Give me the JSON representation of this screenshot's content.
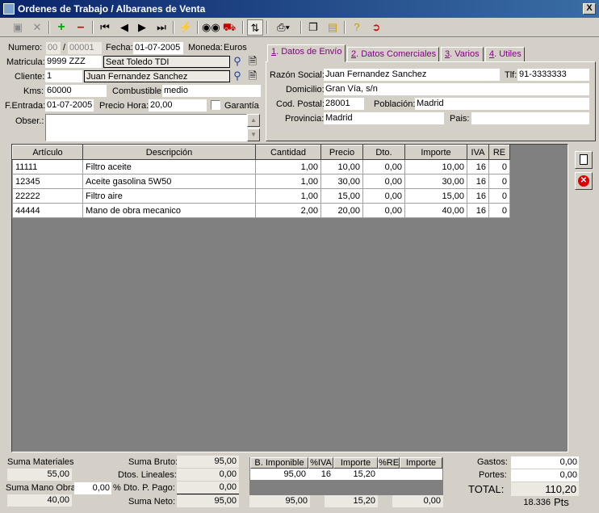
{
  "window": {
    "title": "Ordenes de Trabajo / Albaranes de Venta",
    "close_label": "X"
  },
  "toolbar": {
    "icons": [
      "save-icon",
      "cancel-icon",
      "add-icon",
      "delete-icon",
      "first-icon",
      "prev-icon",
      "next-icon",
      "last-icon",
      "lightning-icon",
      "binoculars-icon",
      "truck-icon",
      "sort-icon",
      "print-icon",
      "copy-icon",
      "note-icon",
      "help-icon",
      "exit-icon"
    ]
  },
  "header": {
    "numero_label": "Numero:",
    "numero_serie": "00",
    "numero_sep": "/",
    "numero_value": "00001",
    "fecha_label": "Fecha:",
    "fecha_value": "01-07-2005",
    "moneda_label": "Moneda:",
    "moneda_value": "Euros",
    "matricula_label": "Matricula:",
    "matricula_value": "9999 ZZZ",
    "vehiculo_value": "Seat Toledo TDI",
    "cliente_label": "Cliente:",
    "cliente_code": "1",
    "cliente_name": "Juan Fernandez Sanchez",
    "kms_label": "Kms:",
    "kms_value": "60000",
    "combustible_label": "Combustible:",
    "combustible_value": "medio",
    "fentrada_label": "F.Entrada:",
    "fentrada_value": "01-07-2005",
    "precio_hora_label": "Precio Hora:",
    "precio_hora_value": "20,00",
    "garantia_label": "Garantía",
    "obser_label": "Obser.:",
    "obser_value": ""
  },
  "tabs": [
    {
      "key": "1",
      "label": ". Datos de Envío"
    },
    {
      "key": "2",
      "label": ". Datos Comerciales"
    },
    {
      "key": "3",
      "label": ". Varios"
    },
    {
      "key": "4",
      "label": ". Utiles"
    }
  ],
  "envio": {
    "razon_label": "Razón Social:",
    "razon_value": "Juan Fernandez Sanchez",
    "tlf_label": "Tlf:",
    "tlf_value": "91-3333333",
    "domicilio_label": "Domicilio:",
    "domicilio_value": "Gran Vía, s/n",
    "cp_label": "Cod. Postal:",
    "cp_value": "28001",
    "poblacion_label": "Población:",
    "poblacion_value": "Madrid",
    "provincia_label": "Provincia:",
    "provincia_value": "Madrid",
    "pais_label": "Pais:",
    "pais_value": ""
  },
  "table": {
    "columns": [
      "Artículo",
      "Descripción",
      "Cantidad",
      "Precio",
      "Dto.",
      "Importe",
      "IVA",
      "RE"
    ],
    "rows": [
      [
        "11111",
        "Filtro aceite",
        "1,00",
        "10,00",
        "0,00",
        "10,00",
        "16",
        "0"
      ],
      [
        "12345",
        "Aceite gasolina 5W50",
        "1,00",
        "30,00",
        "0,00",
        "30,00",
        "16",
        "0"
      ],
      [
        "22222",
        "Filtro aire",
        "1,00",
        "15,00",
        "0,00",
        "15,00",
        "16",
        "0"
      ],
      [
        "44444",
        "Mano de obra mecanico",
        "2,00",
        "20,00",
        "0,00",
        "40,00",
        "16",
        "0"
      ]
    ]
  },
  "totals": {
    "suma_materiales_label": "Suma Materiales",
    "suma_materiales_value": "55,00",
    "suma_mano_label": "Suma Mano Obra",
    "suma_mano_value": "40,00",
    "suma_bruto_label": "Suma Bruto:",
    "suma_bruto_value": "95,00",
    "dtos_lineales_label": "Dtos. Lineales:",
    "dtos_lineales_value": "0,00",
    "dto_pp_pct": "0,00",
    "dto_pp_label": "% Dto. P. Pago:",
    "dto_pp_value": "0,00",
    "suma_neto_label": "Suma Neto:",
    "suma_neto_value": "95,00",
    "iva_columns": [
      "B. Imponible",
      "%IVA",
      "Importe",
      "%RE",
      "Importe"
    ],
    "iva_row": [
      "95,00",
      "16",
      "15,20",
      "",
      ""
    ],
    "iva_totals": [
      "95,00",
      "15,20",
      "0,00"
    ],
    "gastos_label": "Gastos:",
    "gastos_value": "0,00",
    "portes_label": "Portes:",
    "portes_value": "0,00",
    "total_label": "TOTAL:",
    "total_value": "110,20",
    "pts_value": "18.336",
    "pts_label": "Pts"
  }
}
